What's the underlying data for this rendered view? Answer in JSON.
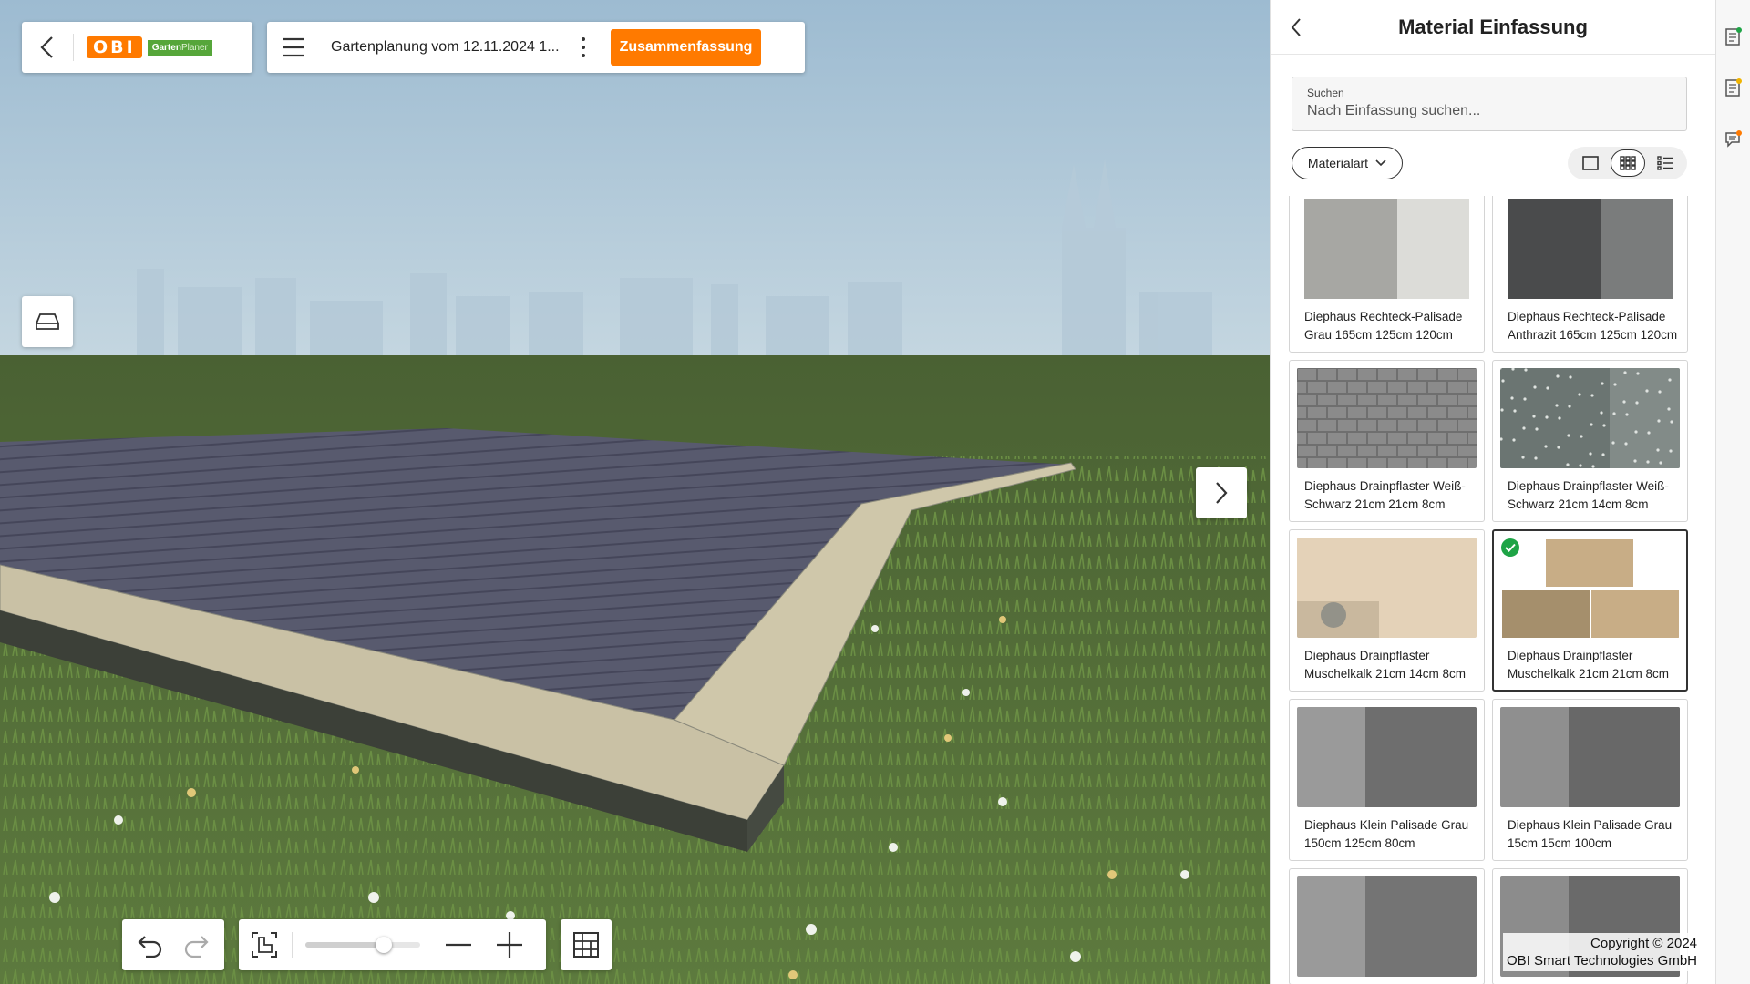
{
  "header": {
    "brand": "OBI",
    "badge_bold": "Garten",
    "badge_light": "Planer",
    "plan_title": "Gartenplanung vom 12.11.2024 1...",
    "summary_label": "Zusammenfassung"
  },
  "toolbar": {
    "zoom_level": 0.68
  },
  "panel": {
    "title": "Material Einfassung",
    "search_label": "Suchen",
    "search_placeholder": "Nach Einfassung suchen...",
    "filter_label": "Materialart",
    "view_modes": [
      "single-view-icon",
      "grid-view-icon",
      "list-view-icon"
    ],
    "active_view_mode": "grid-view-icon"
  },
  "materials": [
    {
      "label": "Diephaus Rechteck-Palisade Grau 165cm 125cm 120cm",
      "texture": "gray-palisade",
      "colors": [
        "#a7a7a3",
        "#dcdcd8"
      ],
      "selected": false
    },
    {
      "label": "Diephaus Rechteck-Palisade Anthrazit 165cm 125cm 120cm",
      "texture": "anthracite-palisade",
      "colors": [
        "#4a4b4c",
        "#7a7c7c"
      ],
      "selected": false
    },
    {
      "label": "Diephaus Drainpflaster Weiß-Schwarz 21cm 21cm 8cm",
      "texture": "paver-grid",
      "colors": [
        "#8b8b8b",
        "#6f6f6f"
      ],
      "selected": false
    },
    {
      "label": "Diephaus Drainpflaster Weiß-Schwarz 21cm 14cm 8cm",
      "texture": "speckled-stone",
      "colors": [
        "#6b7572",
        "#9aa29e"
      ],
      "selected": false
    },
    {
      "label": "Diephaus Drainpflaster Muschelkalk 21cm 14cm 8cm",
      "texture": "shell-limestone",
      "colors": [
        "#e4d2b8",
        "#b8a68c"
      ],
      "selected": false
    },
    {
      "label": "Diephaus Drainpflaster Muschelkalk 21cm 21cm 8cm",
      "texture": "limestone-blocks",
      "colors": [
        "#c8ad86",
        "#a58f6c"
      ],
      "selected": true
    },
    {
      "label": "Diephaus Klein Palisade Grau 150cm 125cm 80cm",
      "texture": "gray-concrete",
      "colors": [
        "#9a9a9a",
        "#6e6e6e"
      ],
      "selected": false
    },
    {
      "label": "Diephaus Klein Palisade Grau 15cm 15cm 100cm",
      "texture": "gray-concrete",
      "colors": [
        "#8f8f8f",
        "#686868"
      ],
      "selected": false
    },
    {
      "label": "",
      "texture": "gray-concrete",
      "colors": [
        "#9a9a9a",
        "#747474"
      ],
      "selected": false
    },
    {
      "label": "",
      "texture": "gray-concrete",
      "colors": [
        "#8c8c8c",
        "#6a6a6a"
      ],
      "selected": false
    }
  ],
  "footer": {
    "copyright_line1": "Copyright © 2024",
    "copyright_line2": "OBI Smart Technologies GmbH"
  },
  "colors": {
    "accent": "#ff7a00",
    "brand_green": "#56a63a",
    "selected_check": "#1ea446",
    "sky": "#a9c4d6",
    "grass": "#4f6b3a",
    "deck": "#55556a",
    "border_stone": "#c7bfa3"
  }
}
